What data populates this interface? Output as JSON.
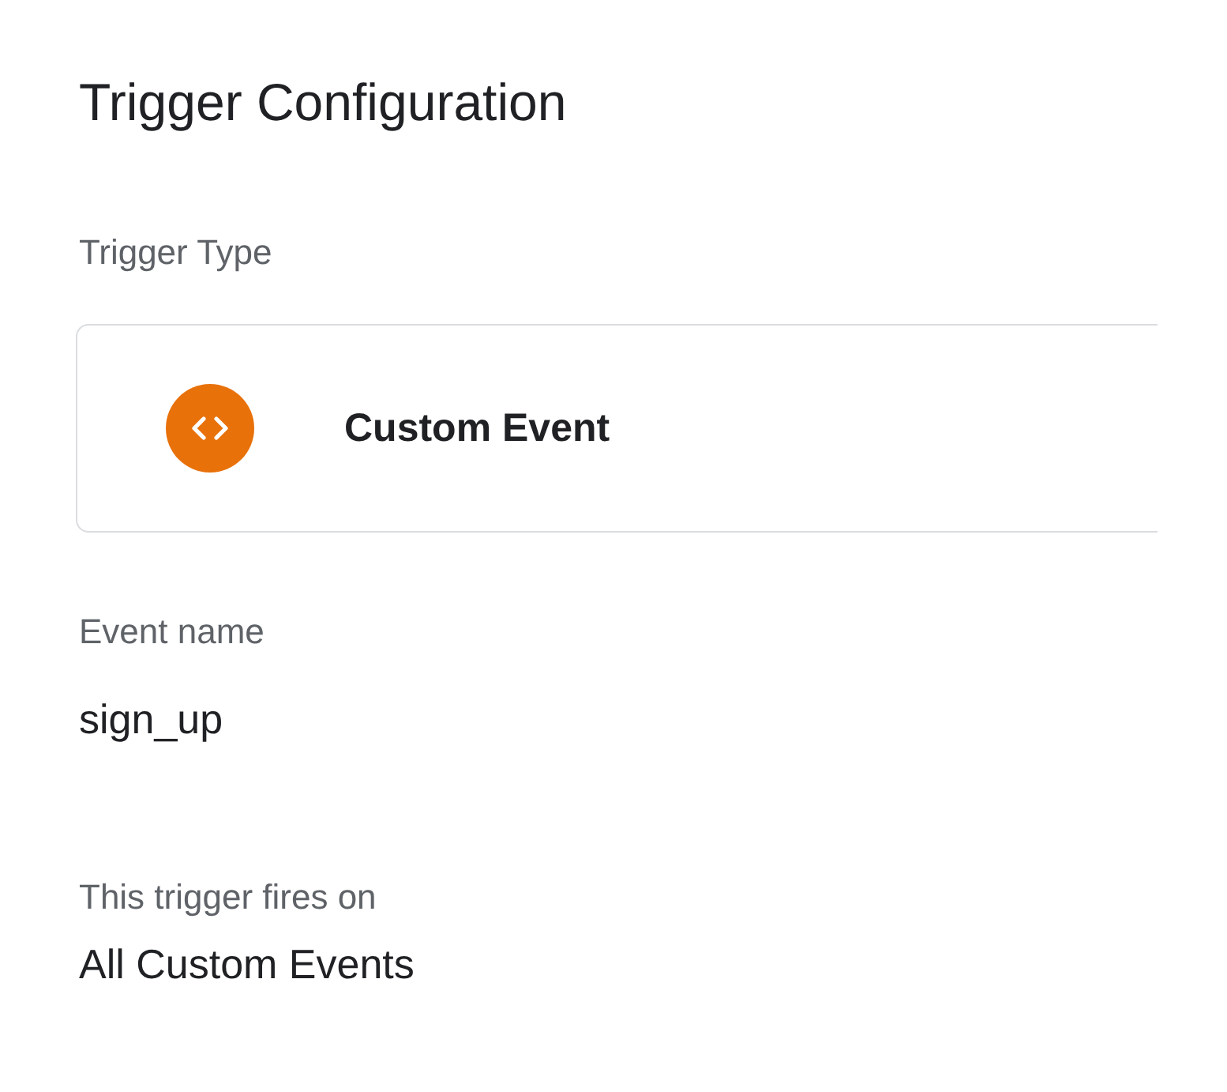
{
  "title": "Trigger Configuration",
  "trigger_type": {
    "label": "Trigger Type",
    "value": "Custom Event"
  },
  "fields": [
    {
      "kind": "field",
      "label": "Event name",
      "value": "sign_up"
    },
    {
      "kind": "section",
      "label": "This trigger fires on",
      "value": "All Custom Events"
    }
  ]
}
